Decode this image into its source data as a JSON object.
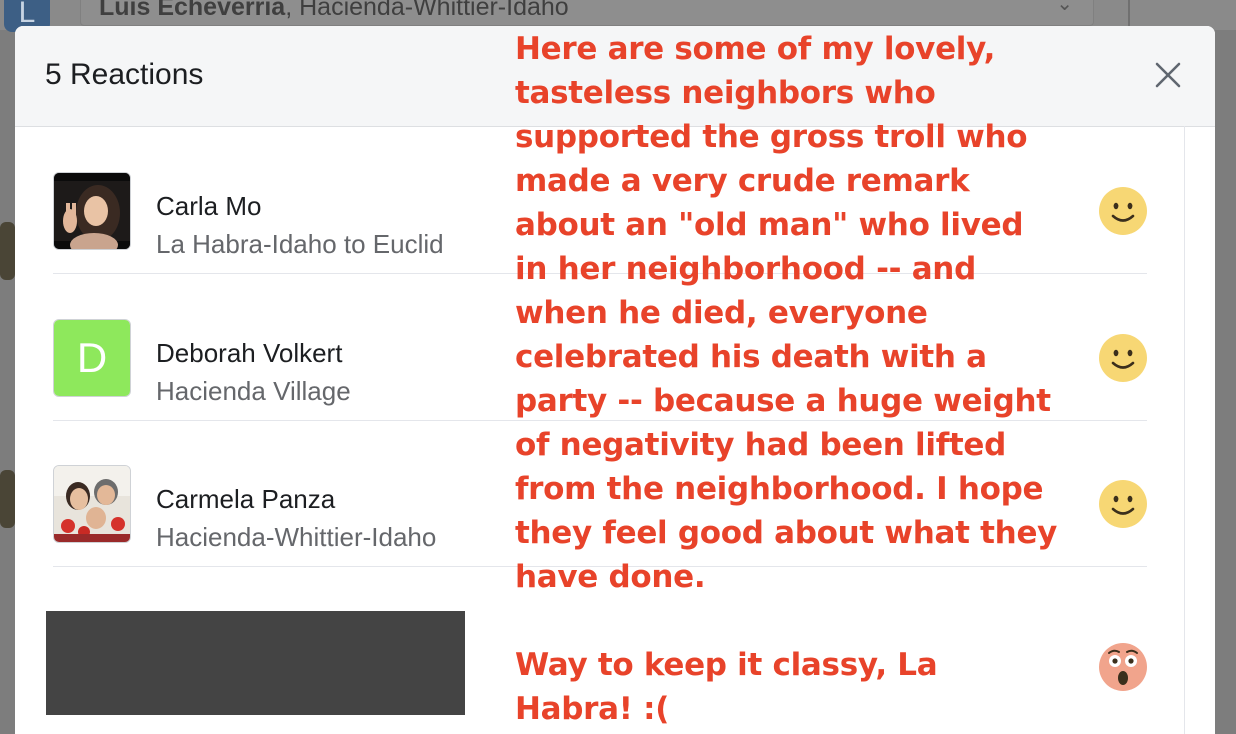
{
  "background": {
    "avatar_letter": "L",
    "selected_user_name": "Luis Echeverria",
    "selected_user_location": ", Hacienda-Whittier-Idaho"
  },
  "modal": {
    "title": "5 Reactions",
    "close_icon": "close-icon",
    "reactions": [
      {
        "name": "Carla Mo",
        "neighborhood": "La Habra-Idaho to Euclid",
        "avatar": "photo",
        "reaction": "smile-emoji"
      },
      {
        "name": "Deborah Volkert",
        "neighborhood": "Hacienda Village",
        "avatar": "letter",
        "avatar_letter": "D",
        "avatar_color": "#8ee85c",
        "reaction": "smile-emoji"
      },
      {
        "name": "Carmela Panza",
        "neighborhood": "Hacienda-Whittier-Idaho",
        "avatar": "photo",
        "reaction": "smile-emoji"
      },
      {
        "name": "",
        "neighborhood": "",
        "avatar": "redacted",
        "reaction": "surprised-emoji"
      }
    ]
  },
  "annotations": {
    "main_text": "Here are some of my lovely,\ntasteless neighbors who\nsupported the gross troll who\nmade a very crude remark\nabout an \"old man\" who lived\nin her neighborhood -- and\nwhen he died, everyone\ncelebrated his death with a\nparty -- because a huge weight\nof negativity had been lifted\nfrom the neighborhood. I hope\nthey feel good about what they\nhave done.",
    "secondary_text": "Way to keep it classy, La\nHabra! :(",
    "color": "#e8432a"
  },
  "colors": {
    "emoji_yellow": "#f7d774",
    "emoji_surprised_face": "#f1a48c",
    "name_text": "#1c1e21",
    "sub_text": "#65676b"
  }
}
